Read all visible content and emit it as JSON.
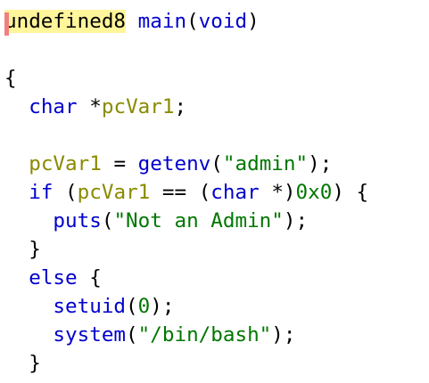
{
  "code": {
    "lines": [
      [
        {
          "t": "undefined8",
          "c": "ret-type",
          "name": "return-type"
        },
        {
          "t": " ",
          "c": "punc"
        },
        {
          "t": "main",
          "c": "fn",
          "name": "function-name"
        },
        {
          "t": "(",
          "c": "punc"
        },
        {
          "t": "void",
          "c": "kw"
        },
        {
          "t": ")",
          "c": "punc"
        }
      ],
      [],
      [
        {
          "t": "{",
          "c": "punc"
        }
      ],
      [
        {
          "t": "  ",
          "c": "punc"
        },
        {
          "t": "char",
          "c": "kw"
        },
        {
          "t": " *",
          "c": "punc"
        },
        {
          "t": "pcVar1",
          "c": "var"
        },
        {
          "t": ";",
          "c": "punc"
        }
      ],
      [],
      [
        {
          "t": "  ",
          "c": "punc"
        },
        {
          "t": "pcVar1",
          "c": "var"
        },
        {
          "t": " = ",
          "c": "punc"
        },
        {
          "t": "getenv",
          "c": "fn"
        },
        {
          "t": "(",
          "c": "punc"
        },
        {
          "t": "\"admin\"",
          "c": "str"
        },
        {
          "t": ");",
          "c": "punc"
        }
      ],
      [
        {
          "t": "  ",
          "c": "punc"
        },
        {
          "t": "if",
          "c": "kw"
        },
        {
          "t": " (",
          "c": "punc"
        },
        {
          "t": "pcVar1",
          "c": "var"
        },
        {
          "t": " == (",
          "c": "punc"
        },
        {
          "t": "char",
          "c": "kw"
        },
        {
          "t": " *)",
          "c": "punc"
        },
        {
          "t": "0x0",
          "c": "num"
        },
        {
          "t": ") {",
          "c": "punc"
        }
      ],
      [
        {
          "t": "    ",
          "c": "punc"
        },
        {
          "t": "puts",
          "c": "fn"
        },
        {
          "t": "(",
          "c": "punc"
        },
        {
          "t": "\"Not an Admin\"",
          "c": "str"
        },
        {
          "t": ");",
          "c": "punc"
        }
      ],
      [
        {
          "t": "  ",
          "c": "punc"
        },
        {
          "t": "}",
          "c": "punc"
        }
      ],
      [
        {
          "t": "  ",
          "c": "punc"
        },
        {
          "t": "else",
          "c": "kw"
        },
        {
          "t": " {",
          "c": "punc"
        }
      ],
      [
        {
          "t": "    ",
          "c": "punc"
        },
        {
          "t": "setuid",
          "c": "fn"
        },
        {
          "t": "(",
          "c": "punc"
        },
        {
          "t": "0",
          "c": "num"
        },
        {
          "t": ");",
          "c": "punc"
        }
      ],
      [
        {
          "t": "    ",
          "c": "punc"
        },
        {
          "t": "system",
          "c": "fn"
        },
        {
          "t": "(",
          "c": "punc"
        },
        {
          "t": "\"/bin/bash\"",
          "c": "str"
        },
        {
          "t": ");",
          "c": "punc"
        }
      ],
      [
        {
          "t": "  ",
          "c": "punc"
        },
        {
          "t": "}",
          "c": "punc"
        }
      ]
    ]
  },
  "colors": {
    "keyword": "#0000cc",
    "variable": "#8a8a00",
    "string": "#007700",
    "highlight": "#fff59a",
    "cursor": "#f08080"
  }
}
